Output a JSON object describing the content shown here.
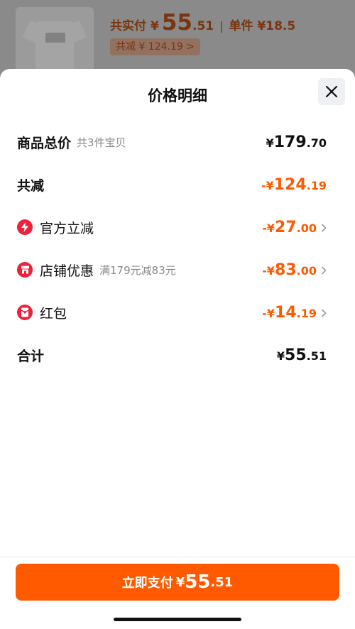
{
  "header": {
    "pay_label": "共实付",
    "yen": "¥",
    "pay_int": "55",
    "pay_dec": ".51",
    "separator": "|",
    "unit_price": "单件 ¥18.5",
    "cut_label": "共减 ¥ 124.19 >"
  },
  "sheet": {
    "title": "价格明细",
    "close_icon": "close-icon"
  },
  "rows": {
    "goods_total": {
      "label": "商品总价",
      "sub": "共3件宝贝",
      "yen": "¥",
      "int": "179",
      "dec": ".70"
    },
    "total_cut": {
      "label": "共减",
      "yen": "-¥",
      "int": "124",
      "dec": ".19"
    },
    "official_cut": {
      "label": "官方立减",
      "yen": "-¥",
      "int": "27",
      "dec": ".00",
      "icon": "lightning-icon"
    },
    "shop_discount": {
      "label": "店铺优惠",
      "sub": "满179元减83元",
      "yen": "-¥",
      "int": "83",
      "dec": ".00",
      "icon": "shop-icon"
    },
    "red_packet": {
      "label": "红包",
      "yen": "-¥",
      "int": "14",
      "dec": ".19",
      "icon": "red-packet-icon"
    },
    "sum": {
      "label": "合计",
      "yen": "¥",
      "int": "55",
      "dec": ".51"
    }
  },
  "pay_button": {
    "label": "立即支付",
    "yen": "¥",
    "int": "55",
    "dec": ".51"
  },
  "colors": {
    "accent": "#ff5a00",
    "icon_red": "#f0203a"
  }
}
